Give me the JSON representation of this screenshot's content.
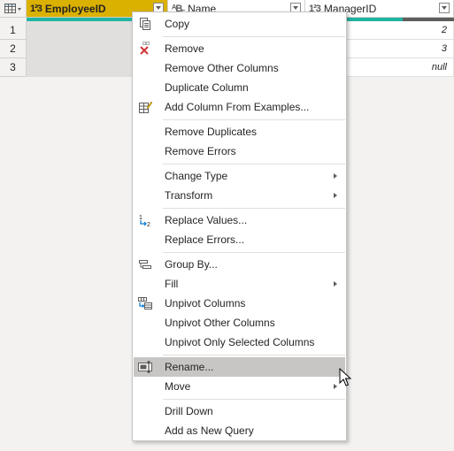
{
  "grid": {
    "columns": [
      {
        "type_icon": "1²3",
        "name": "EmployeeID",
        "selected": true
      },
      {
        "type_icon": "ᴬB꜀",
        "name": "Name",
        "selected": false
      },
      {
        "type_icon": "1²3",
        "name": "ManagerID",
        "selected": false
      }
    ],
    "rows": [
      {
        "num": "1",
        "employee_id": "",
        "name": "",
        "manager_id": "2"
      },
      {
        "num": "2",
        "employee_id": "",
        "name": "",
        "manager_id": "3"
      },
      {
        "num": "3",
        "employee_id": "",
        "name": "",
        "manager_id": "null"
      }
    ]
  },
  "menu": {
    "items": [
      {
        "label": "Copy",
        "icon": "copy-icon"
      },
      {
        "label": "Remove",
        "icon": "remove-column-icon"
      },
      {
        "label": "Remove Other Columns"
      },
      {
        "label": "Duplicate Column"
      },
      {
        "label": "Add Column From Examples...",
        "icon": "column-from-examples-icon"
      },
      {
        "label": "Remove Duplicates"
      },
      {
        "label": "Remove Errors"
      },
      {
        "label": "Change Type",
        "submenu": true
      },
      {
        "label": "Transform",
        "submenu": true
      },
      {
        "label": "Replace Values...",
        "icon": "replace-values-icon"
      },
      {
        "label": "Replace Errors..."
      },
      {
        "label": "Group By...",
        "icon": "group-by-icon"
      },
      {
        "label": "Fill",
        "submenu": true
      },
      {
        "label": "Unpivot Columns",
        "icon": "unpivot-icon"
      },
      {
        "label": "Unpivot Other Columns"
      },
      {
        "label": "Unpivot Only Selected Columns"
      },
      {
        "label": "Rename...",
        "icon": "rename-icon",
        "highlighted": true
      },
      {
        "label": "Move",
        "submenu": true
      },
      {
        "label": "Drill Down"
      },
      {
        "label": "Add as New Query"
      }
    ]
  },
  "colors": {
    "selected_header": "#dbb100",
    "quality_bar_valid": "#1fb4a2",
    "quality_bar_empty": "#605e5c",
    "menu_highlight": "#c8c6c4"
  }
}
